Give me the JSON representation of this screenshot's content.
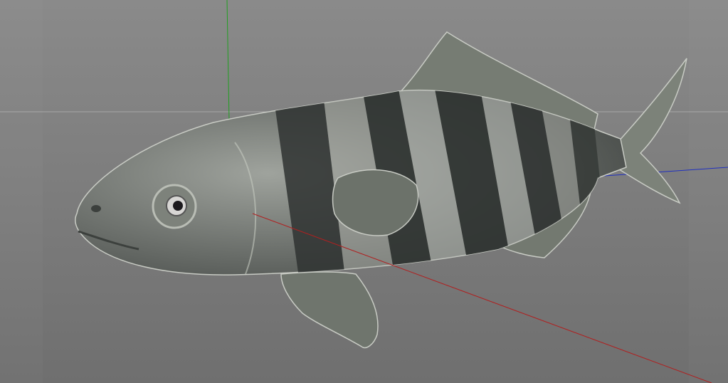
{
  "viewport": {
    "model": "striped-fish",
    "colors": {
      "background": "#7e7e7e",
      "axis_x": "#b02020",
      "axis_y": "#20a020",
      "axis_z": "#2030c0",
      "grid_line": "#a8a8a8",
      "fish_light": "#a9aca6",
      "fish_dark": "#2f3331",
      "fin": "#7c8279"
    }
  }
}
